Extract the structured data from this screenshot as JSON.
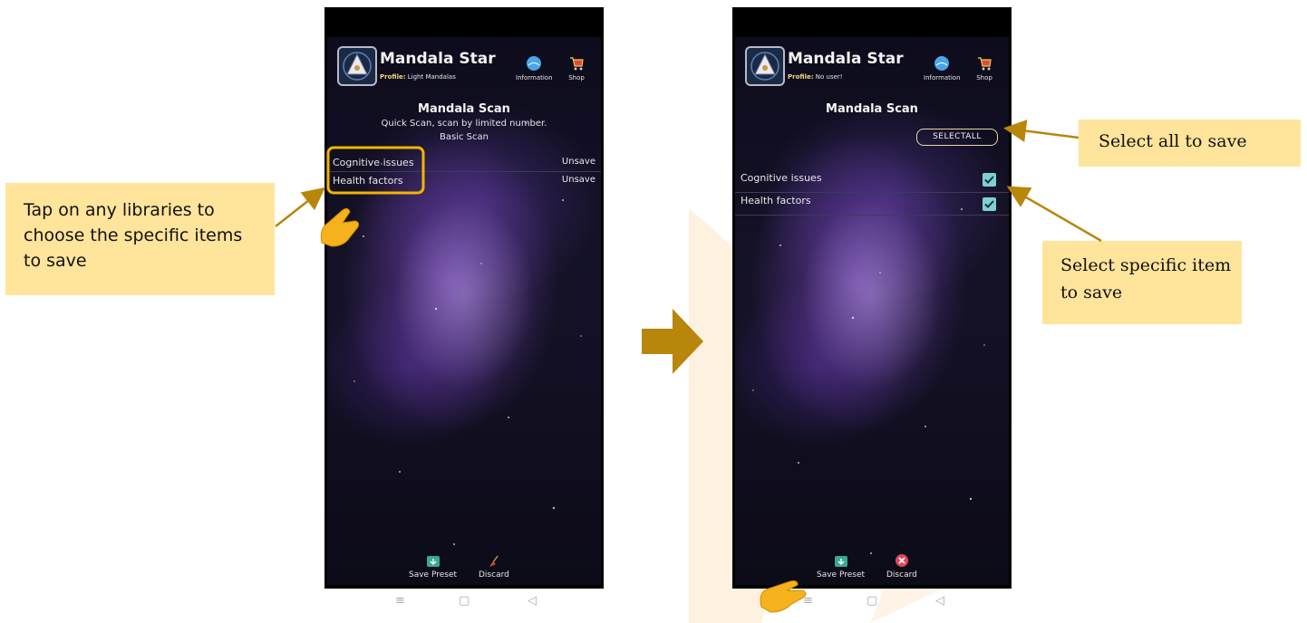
{
  "brand_color": "#b8860b",
  "callout_color": "#ffe49b",
  "left_screen": {
    "app_title": "Mandala Star",
    "profile_label": "Profile:",
    "profile_value": "Light Mandalas",
    "info_label": "Information",
    "shop_label": "Shop",
    "scan_title": "Mandala Scan",
    "scan_subtitle": "Quick Scan, scan by limited number.",
    "scan_type": "Basic Scan",
    "rows": [
      {
        "label": "Cognitive issues",
        "action": "Unsave"
      },
      {
        "label": "Health factors",
        "action": "Unsave"
      }
    ],
    "footer": {
      "save_label": "Save Preset",
      "discard_label": "Discard"
    }
  },
  "right_screen": {
    "app_title": "Mandala Star",
    "profile_label": "Profile:",
    "profile_value": "No user!",
    "info_label": "Information",
    "shop_label": "Shop",
    "scan_title": "Mandala Scan",
    "select_all_label": "SELECTALL",
    "rows": [
      {
        "label": "Cognitive issues",
        "checked": true
      },
      {
        "label": "Health factors",
        "checked": true
      }
    ],
    "footer": {
      "save_label": "Save Preset",
      "discard_label": "Discard"
    }
  },
  "system_nav": {
    "menu_glyph": "≡",
    "home_glyph": "▢",
    "back_glyph": "◁"
  },
  "callouts": {
    "tap_libraries": "Tap on any libraries to choose the specific items to save",
    "select_all": "Select all to save",
    "select_specific": "Select specific item to save"
  },
  "icons": [
    "mandala-logo-icon",
    "information-globe-icon",
    "shop-cart-icon",
    "save-preset-icon",
    "discard-broom-icon",
    "discard-x-icon",
    "checkbox-checked-icon",
    "pointing-hand-icon",
    "right-arrow-icon"
  ]
}
